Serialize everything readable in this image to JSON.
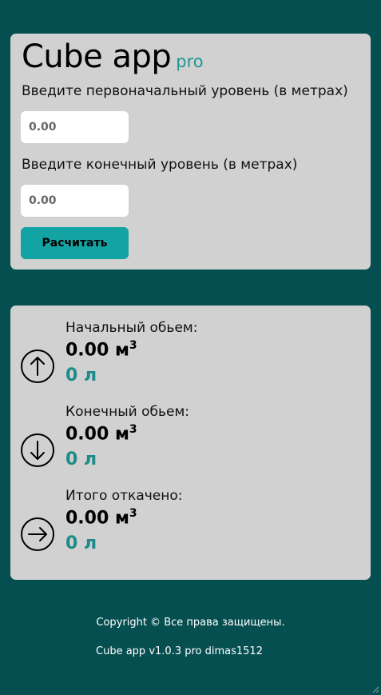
{
  "app": {
    "title": "Cube app",
    "edition": "pro"
  },
  "form": {
    "start_label": "Введите первоначальный уровень (в метрах)",
    "start_placeholder": "0.00",
    "end_label": "Введите конечный уровень (в метрах)",
    "end_placeholder": "0.00",
    "calc_button": "Расчитать"
  },
  "results": [
    {
      "label": "Начальный обьем:",
      "volume": "0.00 м",
      "unit_sup": "3",
      "liters": "0 л",
      "icon": "arrow-up-circle-icon"
    },
    {
      "label": "Конечный обьем:",
      "volume": "0.00 м",
      "unit_sup": "3",
      "liters": "0 л",
      "icon": "arrow-down-circle-icon"
    },
    {
      "label": "Итого откачено:",
      "volume": "0.00 м",
      "unit_sup": "3",
      "liters": "0 л",
      "icon": "arrow-right-circle-icon"
    }
  ],
  "footer": {
    "copyright": "Copyright © Все права защищены.",
    "version": "Cube app v1.0.3 pro dimas1512"
  },
  "colors": {
    "background": "#064f50",
    "card": "#d1d1d1",
    "accent": "#14a3a3",
    "liters_text": "#1e8a8a"
  }
}
